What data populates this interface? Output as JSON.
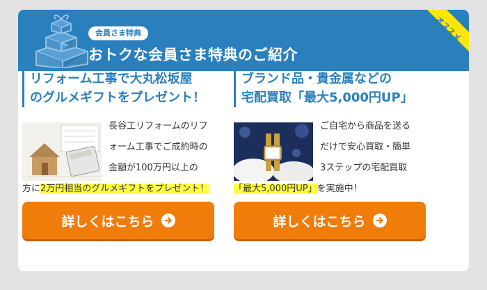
{
  "header": {
    "badge": "会員さま特典",
    "title": "おトクな会員さま特典のご紹介",
    "corner_label": "オススメ"
  },
  "offers": [
    {
      "title_line1": "リフォーム工事で大丸松坂屋",
      "title_line2": "のグルメギフトをプレゼント！",
      "lines": [
        "長谷工リフォームのリフ",
        "ォーム工事でご成約時の",
        "金額が100万円以上の"
      ],
      "last_prefix": "方に",
      "last_highlight": "2万円相当のグルメギフトをプレゼント！",
      "button_label": "詳しくはこちら"
    },
    {
      "title_line1": "ブランド品・貴金属などの",
      "title_line2": "宅配買取「最大5,000円UP」",
      "lines": [
        "ご自宅から商品を送る",
        "だけで安心買取・簡単",
        "3ステップの宅配買取"
      ],
      "last_highlight": "「最大5,000円UP」",
      "last_suffix": "を実施中！",
      "button_label": "詳しくはこちら"
    }
  ],
  "colors": {
    "brand_blue": "#2a7fbd",
    "cta_orange": "#f07c0a",
    "highlight": "#ffff44",
    "ribbon_yellow": "#ffe600"
  }
}
